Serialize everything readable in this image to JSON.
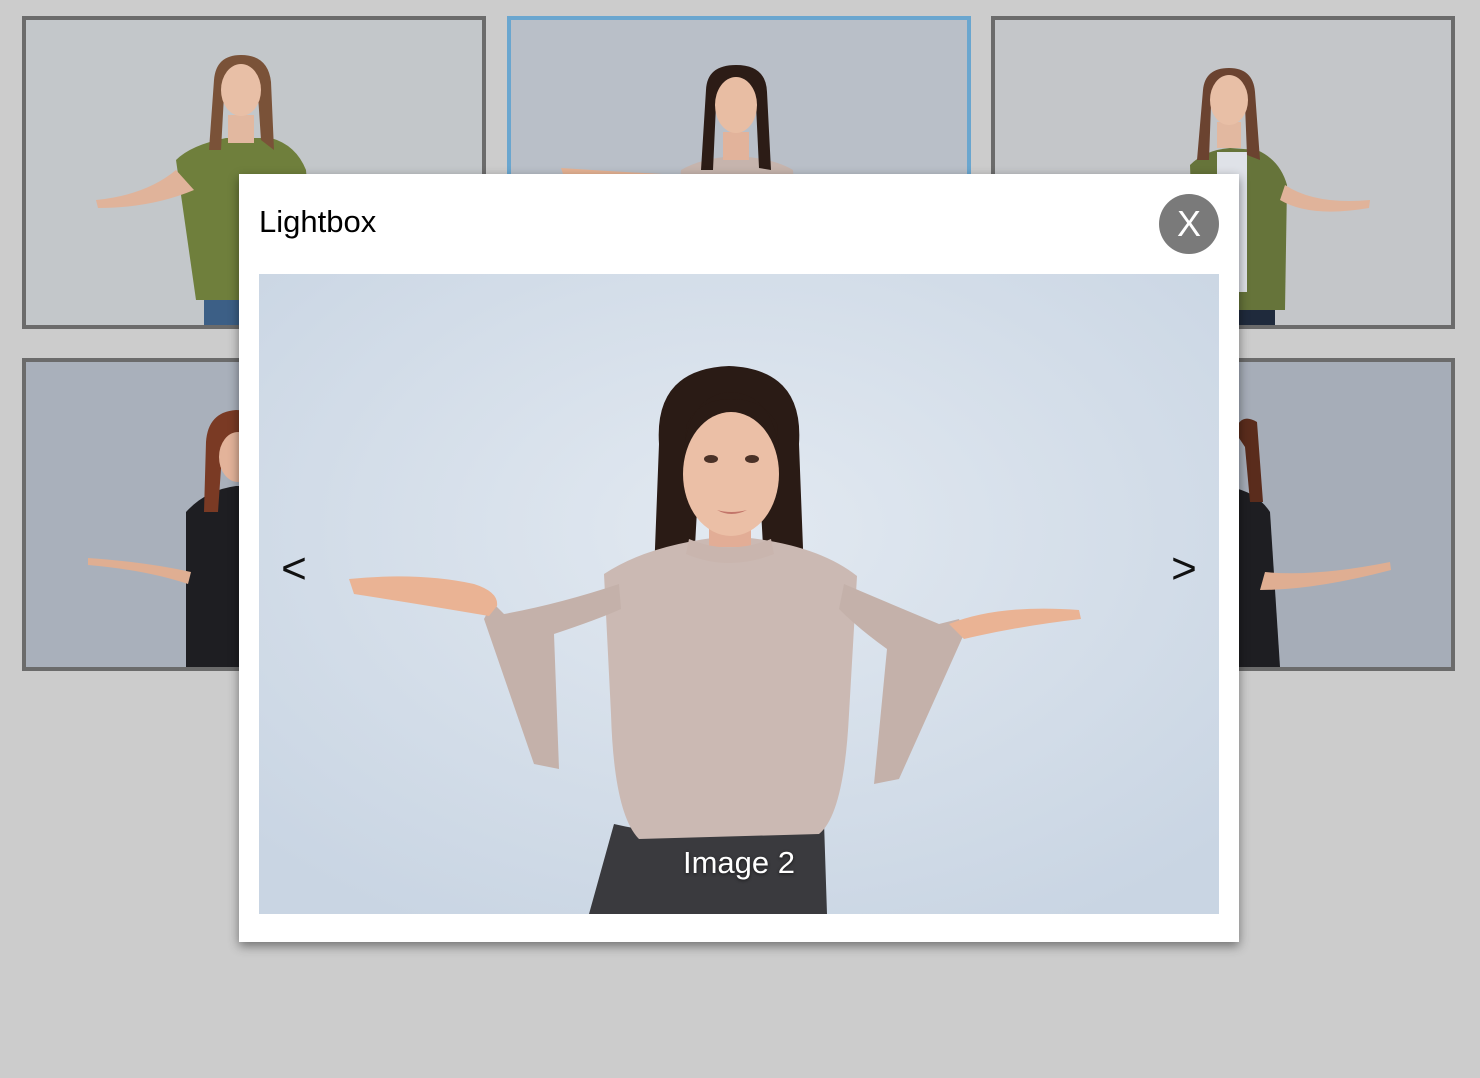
{
  "gallery": {
    "selected_index": 2,
    "colors": {
      "background": "#cccccc",
      "thumb_border": "#6b6b6b",
      "thumb_border_active": "#6aa6cf"
    }
  },
  "lightbox": {
    "title": "Lightbox",
    "close_label": "X",
    "prev_label": "<",
    "next_label": ">",
    "caption": "Image 2",
    "colors": {
      "close_bg": "#7a7a7a",
      "panel_bg": "#ffffff"
    }
  }
}
